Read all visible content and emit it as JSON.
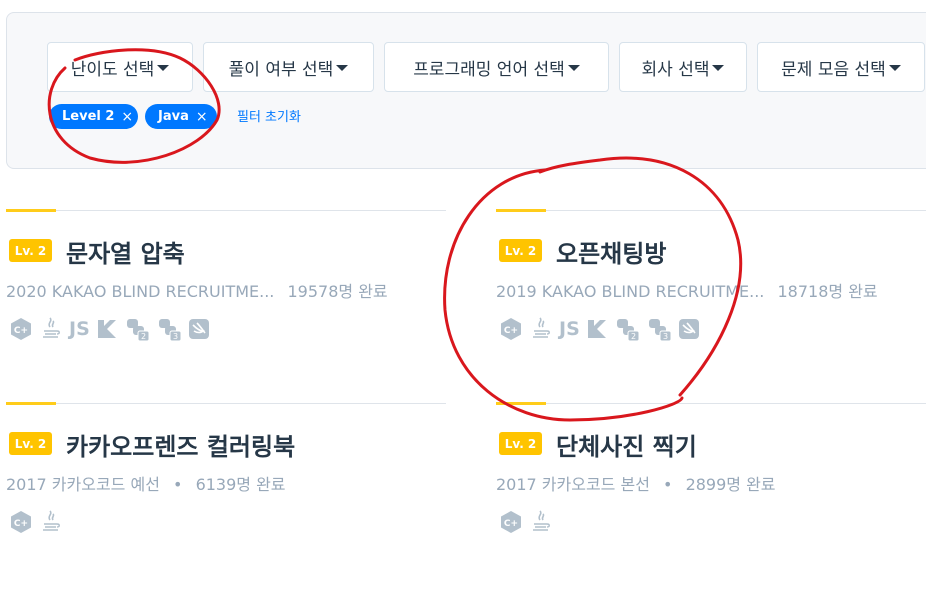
{
  "filters": {
    "difficulty": "난이도 선택",
    "solved": "풀이 여부 선택",
    "language": "프로그래밍 언어 선택",
    "company": "회사 선택",
    "collection": "문제 모음 선택"
  },
  "chips": [
    {
      "label": "Level 2",
      "close": "×"
    },
    {
      "label": "Java",
      "close": "×"
    }
  ],
  "reset_label": "필터 초기화",
  "problems": [
    {
      "level": "Lv. 2",
      "title": "문자열 압축",
      "source": "2020 KAKAO BLIND RECRUITME...",
      "completed": "19578명 완료",
      "languages": [
        "cpp-icon",
        "java-icon",
        "js-icon",
        "kotlin-icon",
        "python2-icon",
        "python3-icon",
        "swift-icon"
      ]
    },
    {
      "level": "Lv. 2",
      "title": "오픈채팅방",
      "source": "2019 KAKAO BLIND RECRUITME...",
      "completed": "18718명 완료",
      "languages": [
        "cpp-icon",
        "java-icon",
        "js-icon",
        "kotlin-icon",
        "python2-icon",
        "python3-icon",
        "swift-icon"
      ]
    },
    {
      "level": "Lv. 2",
      "title": "카카오프렌즈 컬러링북",
      "source": "2017 카카오코드 예선",
      "completed": "6139명 완료",
      "languages": [
        "cpp-icon",
        "java-icon"
      ]
    },
    {
      "level": "Lv. 2",
      "title": "단체사진 찍기",
      "source": "2017 카카오코드 본선",
      "completed": "2899명 완료",
      "languages": [
        "cpp-icon",
        "java-icon"
      ]
    }
  ],
  "lang_text": {
    "js": "JS",
    "py2": "2",
    "py3": "3"
  },
  "colors": {
    "accent_blue": "#0078ff",
    "level_badge": "#ffc400",
    "annotation_red": "#d9171d"
  }
}
